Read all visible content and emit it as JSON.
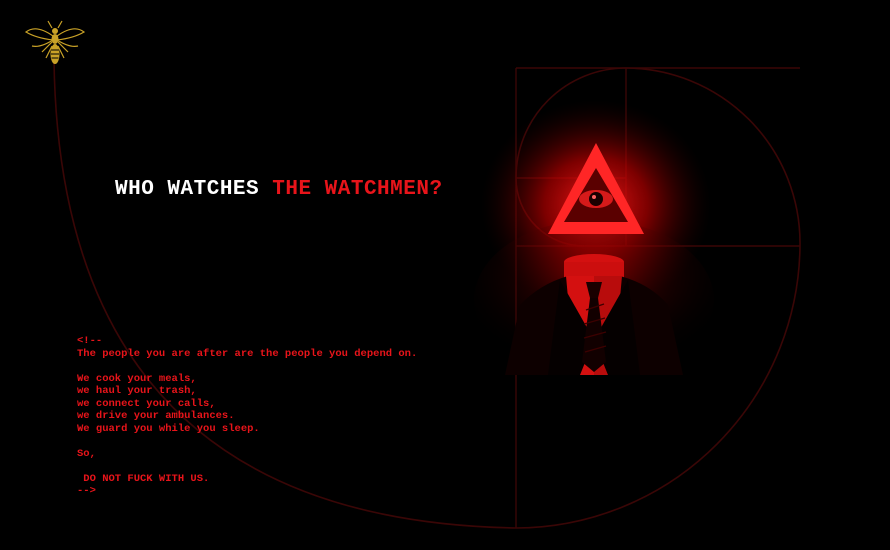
{
  "headline": {
    "part1": "WHO WATCHES",
    "part2": "THE WATCHMEN?"
  },
  "message": {
    "lines": [
      "<!--",
      "The people you are after are the people you depend on.",
      "",
      "We cook your meals,",
      "we haul your trash,",
      "we connect your calls,",
      "we drive your ambulances.",
      "We guard you while you sleep.",
      "",
      "So,",
      "",
      " DO NOT FUCK WITH US.",
      "-->"
    ]
  },
  "icons": {
    "logo": "wasp-icon",
    "figure": "all-seeing-eye-figure"
  },
  "colors": {
    "background": "#000000",
    "accent_red": "#e8141a",
    "headline_white": "#ffffff",
    "logo_gold": "#c9a227"
  }
}
